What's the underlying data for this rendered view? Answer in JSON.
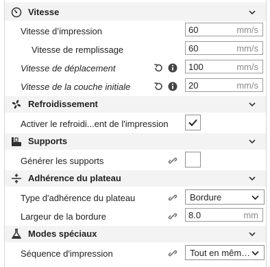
{
  "sections": {
    "speed": {
      "title": "Vitesse",
      "icon": "speedometer-icon"
    },
    "cooling": {
      "title": "Refroidissement",
      "icon": "fan-icon"
    },
    "supports": {
      "title": "Supports",
      "icon": "support-icon"
    },
    "adhesion": {
      "title": "Adhérence du plateau",
      "icon": "adhesion-icon"
    },
    "special": {
      "title": "Modes spéciaux",
      "icon": "flask-icon"
    }
  },
  "settings": {
    "print_speed": {
      "label": "Vitesse d’impression",
      "value": "60",
      "unit": "mm/s"
    },
    "infill_speed": {
      "label": "Vitesse de remplissage",
      "value": "60",
      "unit": "mm/s"
    },
    "travel_speed": {
      "label": "Vitesse de déplacement",
      "value": "100",
      "unit": "mm/s"
    },
    "initial_layer_speed": {
      "label": "Vitesse de la couche initiale",
      "value": "20",
      "unit": "mm/s"
    },
    "enable_cooling": {
      "label": "Activer le refroidi...ent de l'impression",
      "checked": true
    },
    "generate_support": {
      "label": "Générer les supports",
      "checked": false
    },
    "adhesion_type": {
      "label": "Type d'adhérence du plateau",
      "value": "Bordure"
    },
    "brim_width": {
      "label": "Largeur de la bordure",
      "value": "8.0",
      "unit": "mm"
    },
    "print_sequence": {
      "label": "Séquence d'impression",
      "value": "Tout en mêm…"
    }
  },
  "colors": {
    "section_bg": "#f3f3f3",
    "icon": "#2f2f2f",
    "muted": "#8a8a8a"
  }
}
